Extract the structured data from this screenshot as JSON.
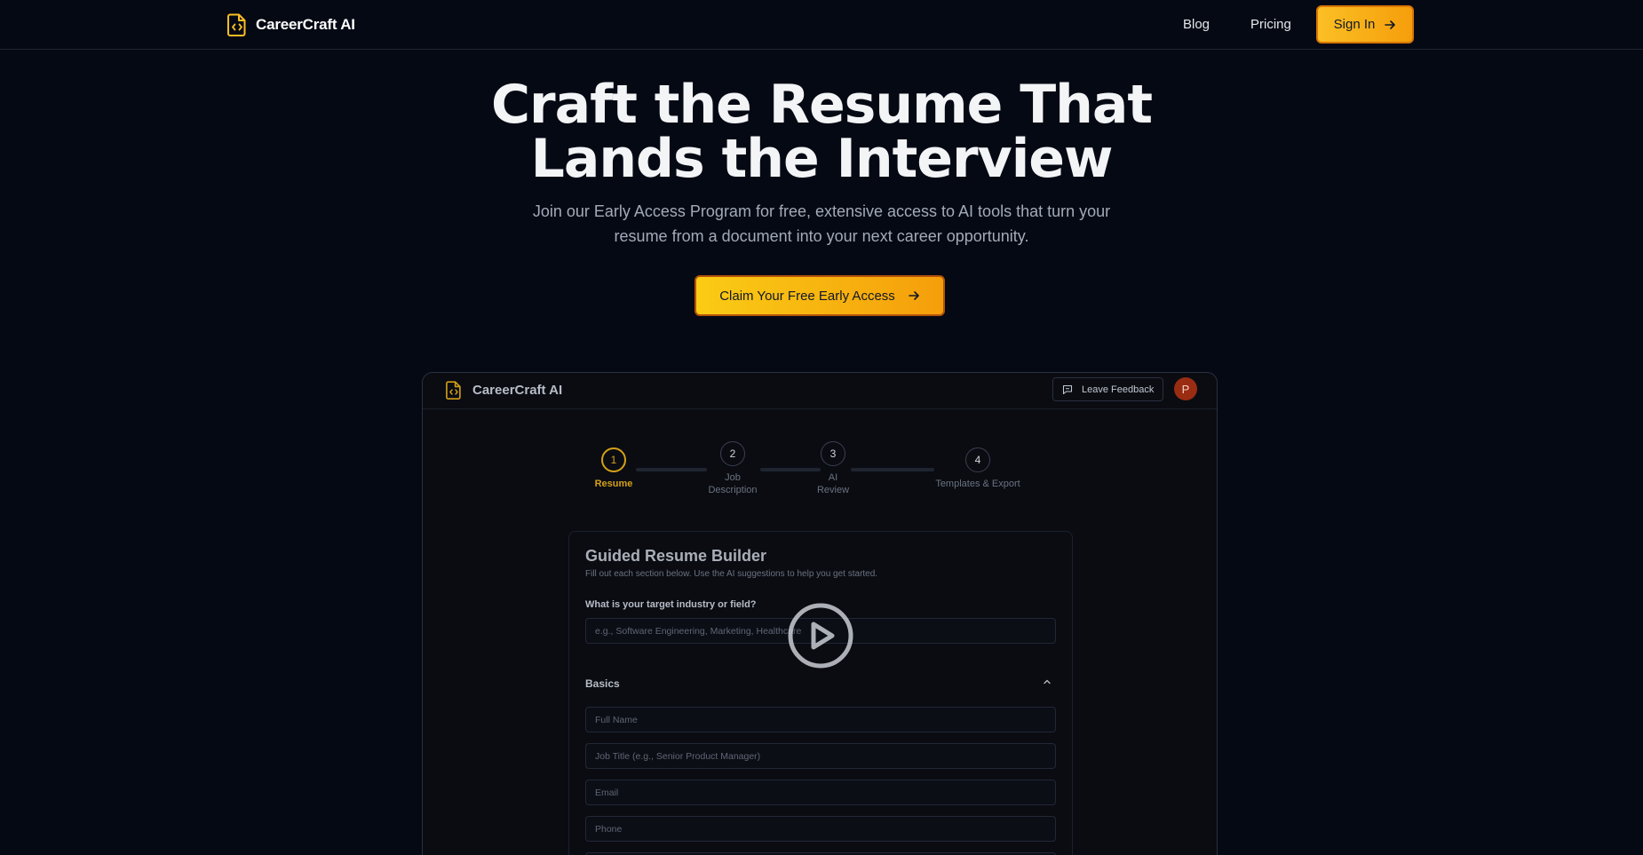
{
  "nav": {
    "brand": "CareerCraft AI",
    "links": [
      "Blog",
      "Pricing"
    ],
    "signin_label": "Sign In"
  },
  "hero": {
    "title_line1": "Craft the Resume That",
    "title_line2": "Lands the Interview",
    "subtitle_line1": "Join our Early Access Program for free, extensive access to AI tools that turn your",
    "subtitle_line2": "resume from a document into your next career opportunity.",
    "cta_label": "Claim Your Free Early Access"
  },
  "preview": {
    "brand": "CareerCraft AI",
    "feedback_label": "Leave Feedback",
    "avatar_initial": "P",
    "steps": [
      {
        "number": "1",
        "label": "Resume"
      },
      {
        "number": "2",
        "label_line1": "Job",
        "label_line2": "Description"
      },
      {
        "number": "3",
        "label_line1": "AI",
        "label_line2": "Review"
      },
      {
        "number": "4",
        "label": "Templates & Export"
      }
    ],
    "builder": {
      "title": "Guided Resume Builder",
      "subtitle": "Fill out each section below. Use the AI suggestions to help you get started.",
      "industry_label": "What is your target industry or field?",
      "industry_placeholder": "e.g., Software Engineering, Marketing, Healthcare",
      "section_title": "Basics",
      "fields": [
        "Full Name",
        "Job Title (e.g., Senior Product Manager)",
        "Email",
        "Phone"
      ]
    }
  },
  "colors": {
    "background": "#050914",
    "accent": "#fbbf24",
    "accent_dark": "#f59e0b",
    "step_active": "#d4a017",
    "avatar": "#9a2c12"
  },
  "icons": [
    "file-code-icon",
    "arrow-right-icon",
    "message-square-icon",
    "chevron-up-icon",
    "play-circle-icon"
  ]
}
